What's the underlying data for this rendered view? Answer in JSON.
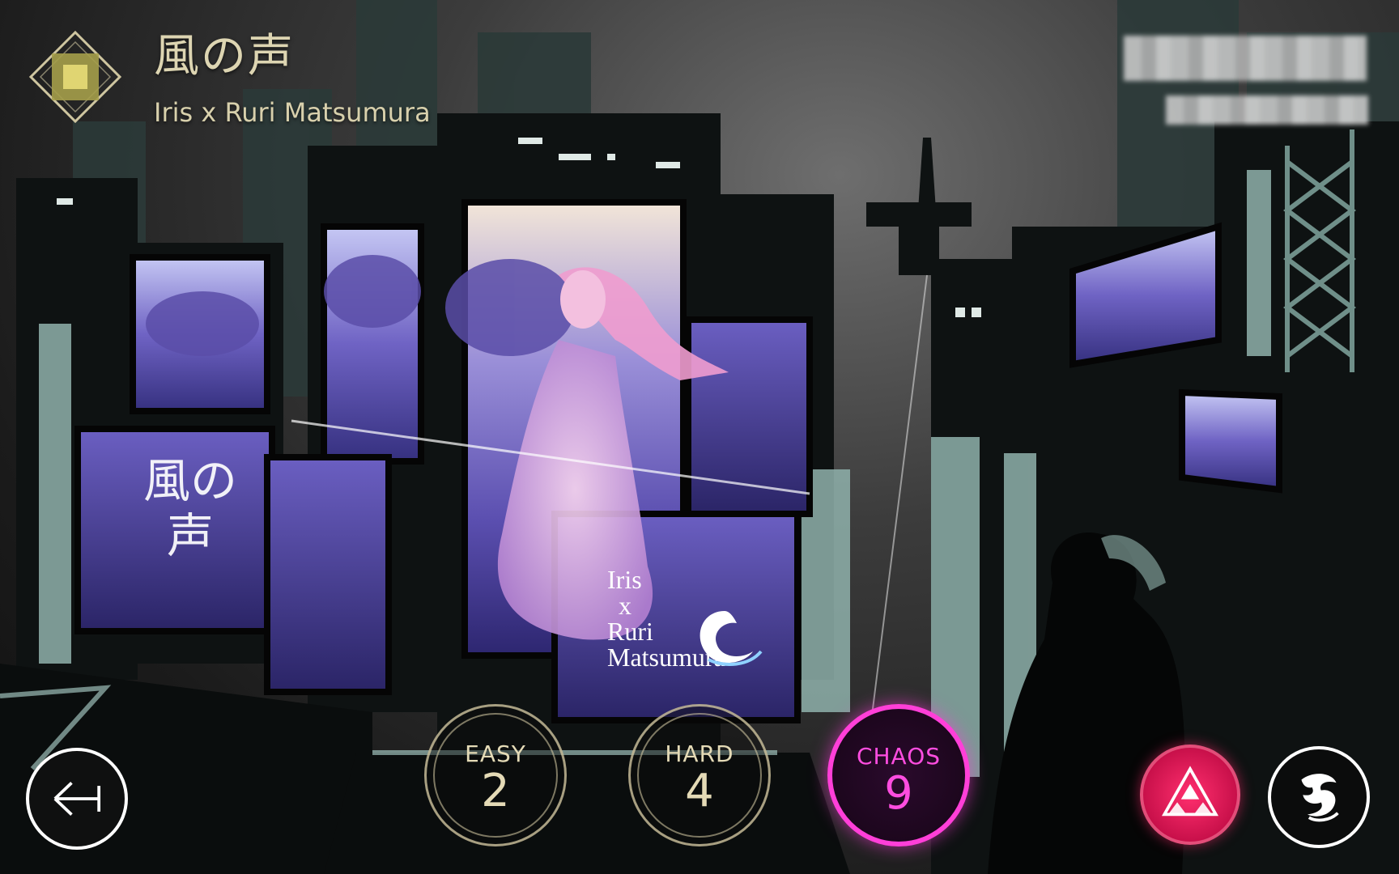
{
  "song": {
    "title": "風の声",
    "artist": "Iris x Ruri Matsumura"
  },
  "cover": {
    "title_text": "風の声",
    "credit_lines": [
      "Iris",
      "x",
      "Ruri",
      "Matsumura"
    ]
  },
  "player_info": {
    "obscured": true
  },
  "difficulties": [
    {
      "name": "EASY",
      "level": "2",
      "selected": false,
      "color": "#e4dab6"
    },
    {
      "name": "HARD",
      "level": "4",
      "selected": false,
      "color": "#e4dab6"
    },
    {
      "name": "CHAOS",
      "level": "9",
      "selected": true,
      "color": "#ff4de0"
    }
  ],
  "buttons": {
    "back_icon": "back-arrow-icon",
    "mode_icon": "triforce-icon",
    "character_icon": "character-emblem-icon"
  },
  "colors": {
    "accent_chaos": "#ff3fd8",
    "accent_mode": "#ff2f6e",
    "text_gold": "#ddd5b2"
  }
}
